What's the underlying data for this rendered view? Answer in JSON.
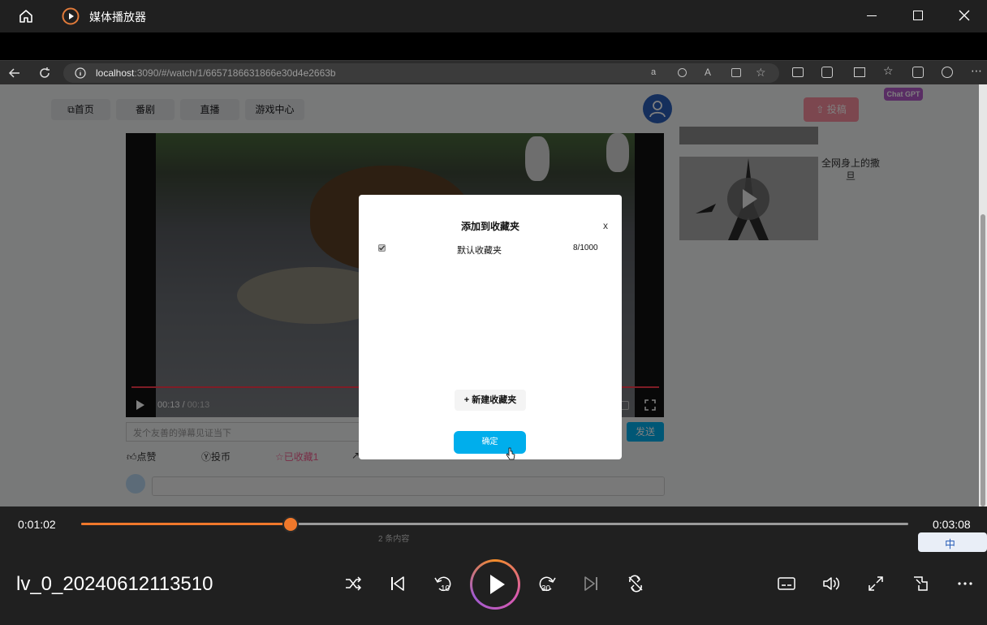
{
  "window": {
    "title": "媒体播放器"
  },
  "browser": {
    "url_host": "localhost",
    "url_rest": ":3090/#/watch/1/6657186631866e30d4e2663b"
  },
  "site": {
    "nav": [
      "首页",
      "番剧",
      "直播",
      "游戏中心"
    ],
    "upload_label": "投稿",
    "badge": "Chat GPT",
    "video_time_current": "00:13",
    "video_time_total": "00:13",
    "danmaku_placeholder": "发个友善的弹幕见证当下",
    "send_label": "发送",
    "actions": {
      "like": "点赞",
      "coin": "投币",
      "favorited": "已收藏1"
    },
    "side_title": "全网身上的撒旦",
    "comment_count": "2 条内容"
  },
  "modal": {
    "title": "添加到收藏夹",
    "close": "x",
    "folder_name": "默认收藏夹",
    "folder_count": "8/1000",
    "new_folder": "+ 新建收藏夹",
    "confirm": "确定"
  },
  "player": {
    "current_time": "0:01:02",
    "total_time": "0:03:08",
    "progress_fraction": 0.253,
    "media_title": "lv_0_20240612113510",
    "accent": "#f0782b",
    "ime": "中"
  },
  "icons": [
    "home-icon",
    "app-icon",
    "minimize-icon",
    "maximize-icon",
    "close-icon",
    "back-icon",
    "refresh-icon",
    "info-icon",
    "shuffle-icon",
    "previous-icon",
    "rewind-10-icon",
    "play-icon",
    "forward-30-icon",
    "next-icon",
    "repeat-icon",
    "subtitles-icon",
    "volume-icon",
    "fullscreen-icon",
    "miniplayer-icon",
    "more-icon"
  ]
}
